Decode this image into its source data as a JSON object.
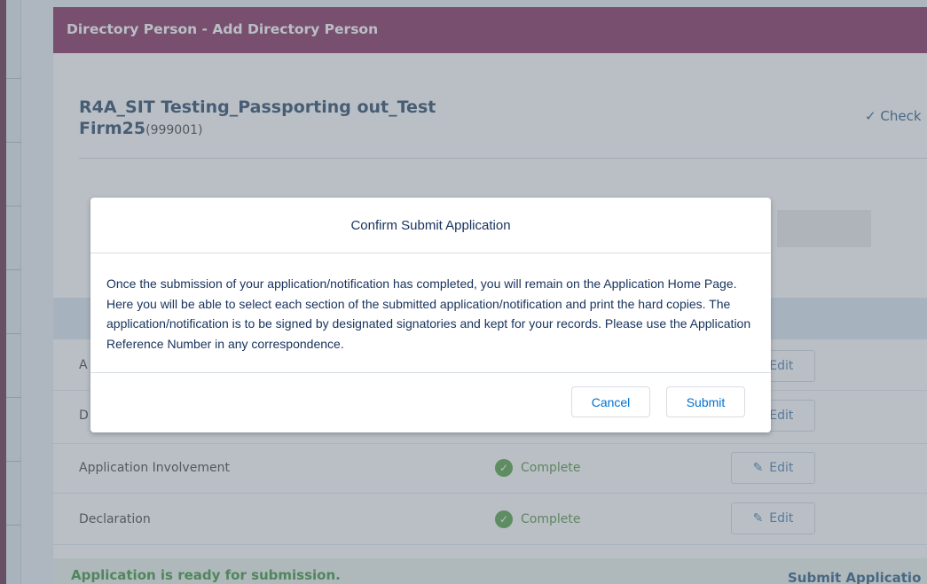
{
  "page": {
    "header_title": "Directory Person - Add Directory Person",
    "firm_name": "R4A_SIT Testing_Passporting out_Test Firm25",
    "firm_id": "(999001)",
    "check_link": "Check",
    "rows": [
      {
        "name": "A",
        "status": "",
        "edit": "Edit"
      },
      {
        "name": "D",
        "status": "",
        "edit": "Edit"
      },
      {
        "name": "Application Involvement",
        "status": "Complete",
        "edit": "Edit"
      },
      {
        "name": "Declaration",
        "status": "Complete",
        "edit": "Edit"
      }
    ],
    "ready_message": "Application is ready for submission.",
    "submit_application_link": "Submit Applicatio"
  },
  "modal": {
    "title": "Confirm Submit Application",
    "body": "Once the submission of your application/notification has completed, you will remain on the Application Home Page. Here you will be able to select each section of the submitted application/notification and print the hard copies. The application/notification is to be signed by designated signatories and kept for your records. Please use the Application Reference Number in any correspondence.",
    "cancel_label": "Cancel",
    "submit_label": "Submit"
  },
  "colors": {
    "header": "#7d1f53",
    "accent_blue": "#0070d2",
    "complete_green": "#4b9a38",
    "ready_green": "#2f8a2f"
  }
}
